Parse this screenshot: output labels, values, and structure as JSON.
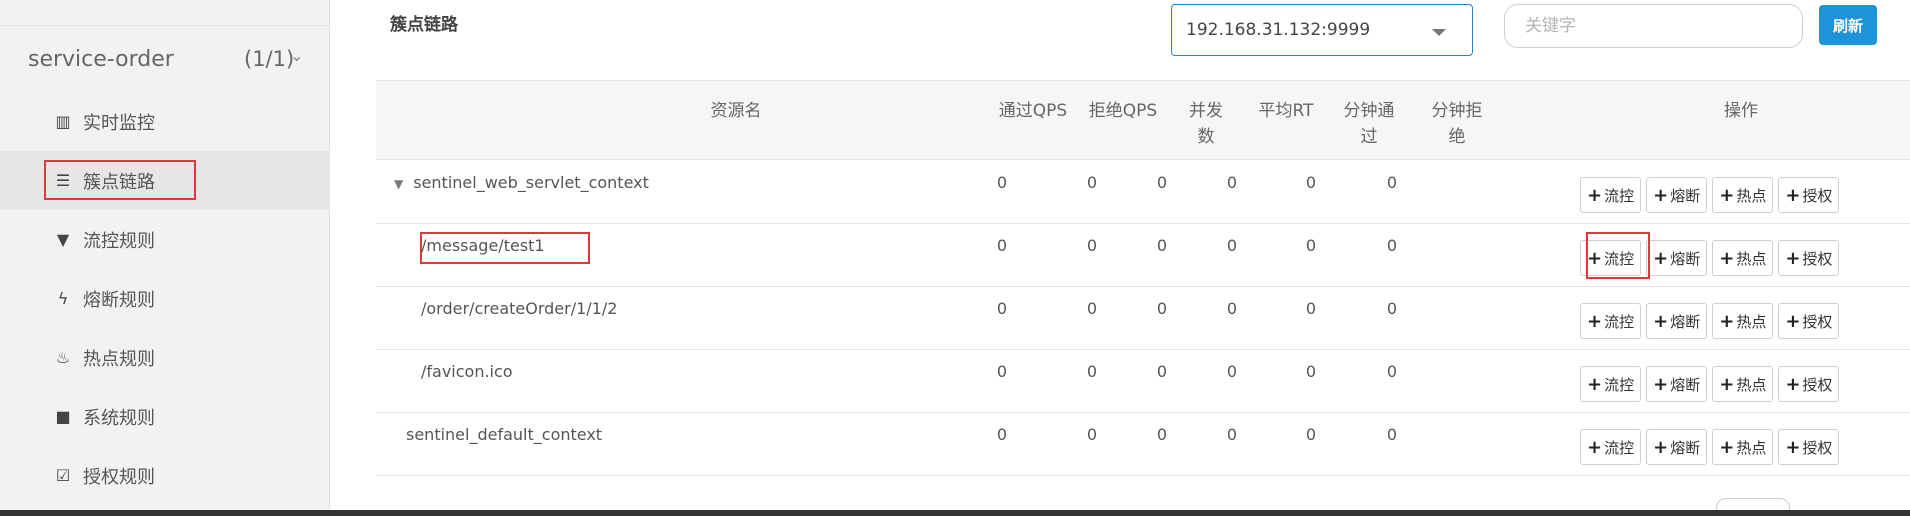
{
  "sidebar": {
    "app": {
      "name": "service-order",
      "count": "(1/1)",
      "chevron": "chevron-down-icon"
    },
    "items": [
      {
        "label": "实时监控",
        "icon": "bar-chart-icon",
        "glyph": "▥"
      },
      {
        "label": "簇点链路",
        "icon": "list-icon",
        "glyph": "☰"
      },
      {
        "label": "流控规则",
        "icon": "filter-icon",
        "glyph": "▼"
      },
      {
        "label": "熔断规则",
        "icon": "flash-icon",
        "glyph": "ϟ"
      },
      {
        "label": "热点规则",
        "icon": "fire-icon",
        "glyph": "♨"
      },
      {
        "label": "系统规则",
        "icon": "briefcase-icon",
        "glyph": "■"
      },
      {
        "label": "授权规则",
        "icon": "checkbox-icon",
        "glyph": "☑"
      }
    ]
  },
  "header": {
    "title": "簇点链路",
    "machine": "192.168.31.132:9999",
    "search_placeholder": "关键字",
    "refresh_label": "刷新"
  },
  "table": {
    "headers": {
      "resource": "资源名",
      "pass_qps": "通过QPS",
      "block_qps": "拒绝QPS",
      "concurrency_line1": "并发",
      "concurrency_line2": "数",
      "avg_rt": "平均RT",
      "minute_pass_line1": "分钟通",
      "minute_pass_line2": "过",
      "minute_block_line1": "分钟拒",
      "minute_block_line2": "绝",
      "actions": "操作"
    },
    "rows": [
      {
        "name": "sentinel_web_servlet_context",
        "expanded": true,
        "pass_qps": "0",
        "block_qps": "0",
        "concurrency": "0",
        "avg_rt": "0",
        "minute_pass": "0",
        "minute_block": "0"
      },
      {
        "name": "/message/test1",
        "pass_qps": "0",
        "block_qps": "0",
        "concurrency": "0",
        "avg_rt": "0",
        "minute_pass": "0",
        "minute_block": "0"
      },
      {
        "name": "/order/createOrder/1/1/2",
        "pass_qps": "0",
        "block_qps": "0",
        "concurrency": "0",
        "avg_rt": "0",
        "minute_pass": "0",
        "minute_block": "0"
      },
      {
        "name": "/favicon.ico",
        "pass_qps": "0",
        "block_qps": "0",
        "concurrency": "0",
        "avg_rt": "0",
        "minute_pass": "0",
        "minute_block": "0"
      },
      {
        "name": "sentinel_default_context",
        "pass_qps": "0",
        "block_qps": "0",
        "concurrency": "0",
        "avg_rt": "0",
        "minute_pass": "0",
        "minute_block": "0"
      }
    ],
    "actions": {
      "flow": "流控",
      "degrade": "熔断",
      "hotspot": "热点",
      "authority": "授权"
    }
  },
  "colors": {
    "accent": "#1f93d8",
    "highlight": "#d93b3b"
  }
}
